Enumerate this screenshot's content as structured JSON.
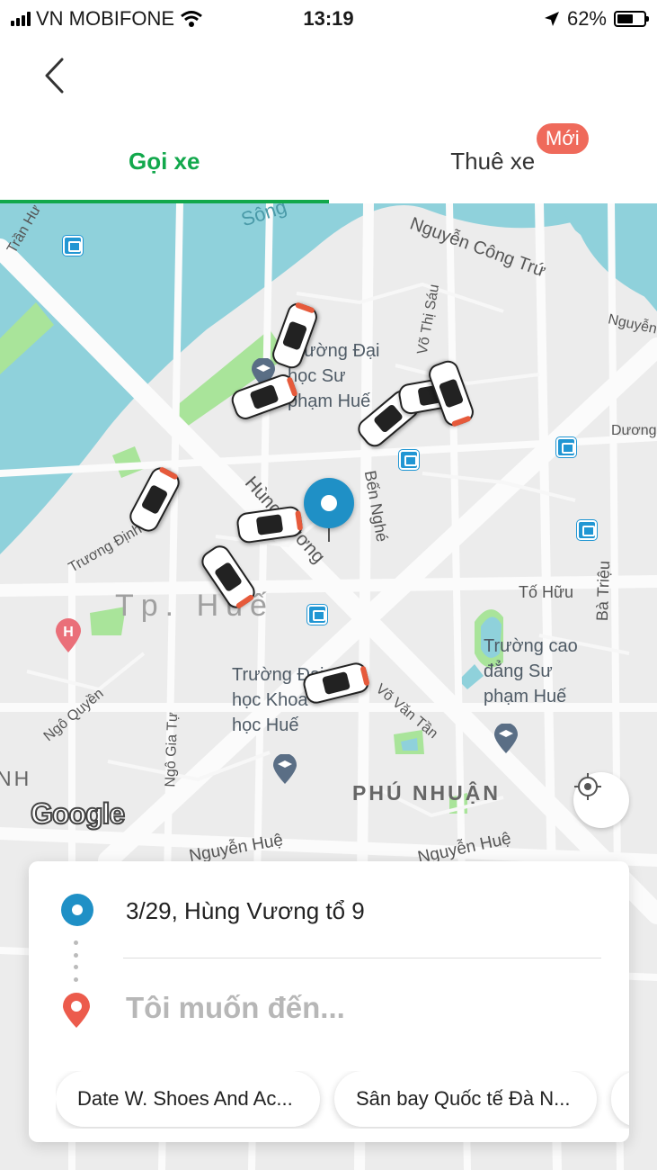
{
  "status_bar": {
    "carrier": "VN MOBIFONE",
    "time": "13:19",
    "battery": "62%",
    "battery_level": 0.62
  },
  "tabs": [
    {
      "label": "Gọi xe",
      "active": true
    },
    {
      "label": "Thuê xe",
      "active": false,
      "badge": "Mới"
    }
  ],
  "map": {
    "streets": [
      "Nguyễn Công Trứ",
      "Nguyễn",
      "Võ Thị Sáu",
      "Dương",
      "Trần Hư",
      "Trương Định",
      "Hùng Vương",
      "Bến Nghé",
      "Tố Hữu",
      "Bà Triệu",
      "Ngô Quyền",
      "Ngô Gia Tự",
      "Võ Văn Tần",
      "Nguyễn Huệ",
      "Nguyễn Huệ",
      "Sông"
    ],
    "areas": [
      "Tp. Huế",
      "PHÚ NHUẬN",
      "NH"
    ],
    "pois": [
      "Trường Đại học Sư phạm Huế",
      "Trường Đại học Khoa học Huế",
      "Trường cao đẳng Sư phạm Huế"
    ],
    "attribution": "Google",
    "colors": {
      "water": "#8fd1db",
      "park": "#a9e49a",
      "road": "#fafafa",
      "land": "#ececec"
    }
  },
  "booking": {
    "origin": "3/29, Hùng Vương tổ 9",
    "destination_placeholder": "Tôi muốn đến...",
    "suggestions": [
      "Date W. Shoes And Ac...",
      "Sân bay Quốc tế Đà N..."
    ]
  },
  "colors": {
    "accent": "#12a84c",
    "badge": "#ef6a5b",
    "pin": "#1f90c6",
    "dest_pin": "#ec5b4c"
  }
}
